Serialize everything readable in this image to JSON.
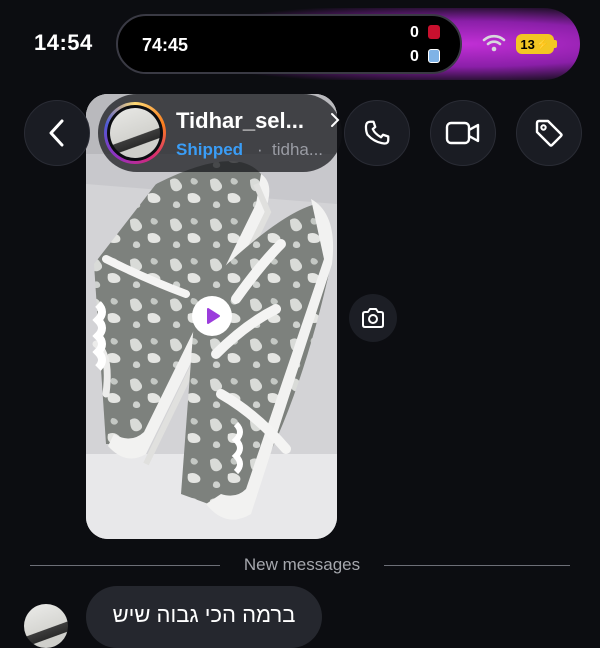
{
  "status_bar": {
    "time": "14:54",
    "live_activity": {
      "timer": "74:45",
      "home_score": "0",
      "away_score": "0"
    },
    "battery": "13"
  },
  "header": {
    "username": "Tidhar_sel...",
    "status": "Shipped",
    "separator": "·",
    "handle": "tidha..."
  },
  "conversation": {
    "new_messages_label": "New messages",
    "messages": [
      {
        "text": "ברמה הכי גבוה שיש"
      }
    ]
  },
  "colors": {
    "background": "#0c0d11",
    "status_blue": "#3a9df6",
    "bubble": "#25272e",
    "island_glow": "#c22fd6",
    "battery": "#f3c623"
  },
  "icons": [
    "back-chevron-icon",
    "phone-icon",
    "video-camera-icon",
    "tag-icon",
    "play-icon",
    "camera-icon",
    "wifi-icon",
    "battery-icon"
  ]
}
